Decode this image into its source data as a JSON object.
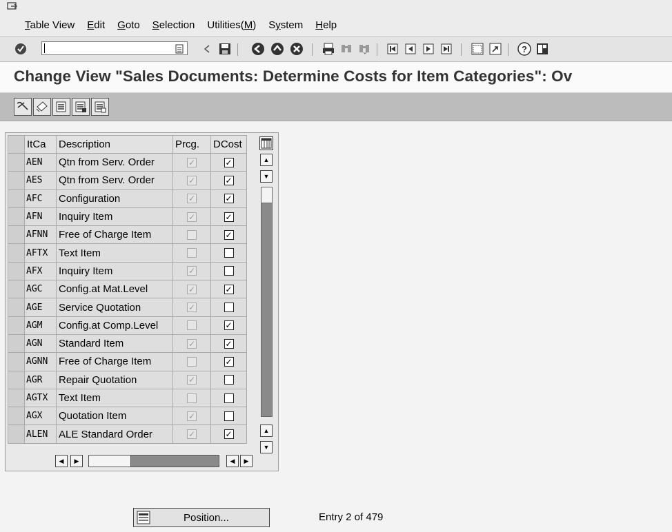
{
  "menu": {
    "items": [
      {
        "prefix": "",
        "ul": "T",
        "rest": "able View"
      },
      {
        "prefix": "",
        "ul": "E",
        "rest": "dit"
      },
      {
        "prefix": "",
        "ul": "G",
        "rest": "oto"
      },
      {
        "prefix": "",
        "ul": "S",
        "rest": "election"
      },
      {
        "prefix": "Utilities(",
        "ul": "M",
        "rest": ")"
      },
      {
        "prefix": "S",
        "ul": "y",
        "rest": "stem"
      },
      {
        "prefix": "",
        "ul": "H",
        "rest": "elp"
      }
    ]
  },
  "toolbar": {
    "command_value": "",
    "icons": [
      "enter-icon",
      "history-icon",
      "back-arrow-icon",
      "save-icon",
      "back-icon",
      "exit-icon",
      "cancel-icon",
      "print-icon",
      "find-icon",
      "find-next-icon",
      "first-page-icon",
      "previous-page-icon",
      "next-page-icon",
      "last-page-icon",
      "create-session-icon",
      "shortcut-icon",
      "help-icon",
      "layout-icon"
    ]
  },
  "title": "Change View \"Sales Documents: Determine Costs for Item Categories\": Ov",
  "app_toolbar": {
    "icons": [
      "display-change-icon",
      "other-view-icon",
      "select-all-icon",
      "select-block-icon",
      "deselect-all-icon"
    ]
  },
  "table": {
    "headers": {
      "itca": "ItCa",
      "description": "Description",
      "prcg": "Prcg.",
      "dcost": "DCost"
    },
    "rows": [
      {
        "itca": "AEN",
        "desc": "Qtn from Serv. Order",
        "prcg": true,
        "dcost": true
      },
      {
        "itca": "AES",
        "desc": "Qtn from Serv. Order",
        "prcg": true,
        "dcost": true
      },
      {
        "itca": "AFC",
        "desc": "Configuration",
        "prcg": true,
        "dcost": true
      },
      {
        "itca": "AFN",
        "desc": "Inquiry Item",
        "prcg": true,
        "dcost": true
      },
      {
        "itca": "AFNN",
        "desc": "Free of Charge Item",
        "prcg": false,
        "dcost": true
      },
      {
        "itca": "AFTX",
        "desc": "Text Item",
        "prcg": false,
        "dcost": false
      },
      {
        "itca": "AFX",
        "desc": "Inquiry Item",
        "prcg": true,
        "dcost": false
      },
      {
        "itca": "AGC",
        "desc": "Config.at Mat.Level",
        "prcg": true,
        "dcost": true
      },
      {
        "itca": "AGE",
        "desc": "Service Quotation",
        "prcg": true,
        "dcost": false
      },
      {
        "itca": "AGM",
        "desc": "Config.at Comp.Level",
        "prcg": false,
        "dcost": true
      },
      {
        "itca": "AGN",
        "desc": "Standard Item",
        "prcg": true,
        "dcost": true
      },
      {
        "itca": "AGNN",
        "desc": "Free of Charge Item",
        "prcg": false,
        "dcost": true
      },
      {
        "itca": "AGR",
        "desc": "Repair Quotation",
        "prcg": true,
        "dcost": false
      },
      {
        "itca": "AGTX",
        "desc": "Text Item",
        "prcg": false,
        "dcost": false
      },
      {
        "itca": "AGX",
        "desc": "Quotation Item",
        "prcg": true,
        "dcost": false
      },
      {
        "itca": "ALEN",
        "desc": "ALE Standard Order",
        "prcg": true,
        "dcost": true
      }
    ]
  },
  "position_button": {
    "label": "Position..."
  },
  "entry_info": "Entry 2 of 479",
  "colors": {
    "title": "#333333",
    "app_toolbar": "#bcbcbc",
    "scroll_track": "#8a8a8a"
  }
}
